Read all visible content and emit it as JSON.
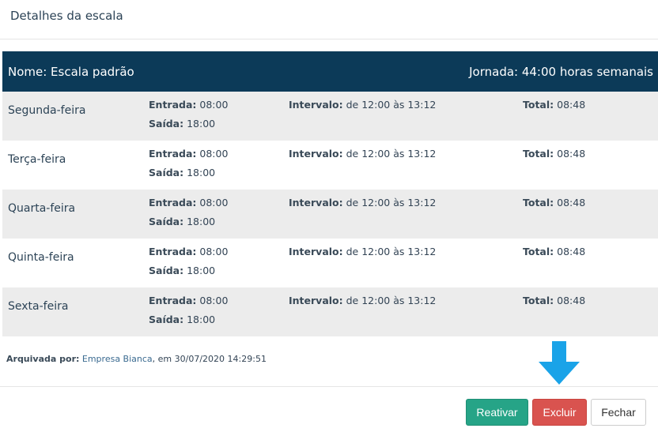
{
  "modal": {
    "title": "Detalhes da escala"
  },
  "schedule": {
    "name_text": "Nome: Escala padrão",
    "jornada_text": "Jornada: 44:00 horas semanais",
    "labels": {
      "entrada": "Entrada:",
      "saida": "Saída:",
      "intervalo": "Intervalo:",
      "total": "Total:"
    },
    "days": [
      {
        "name": "Segunda-feira",
        "entrada": "08:00",
        "saida": "18:00",
        "intervalo": "de 12:00 às 13:12",
        "total": "08:48"
      },
      {
        "name": "Terça-feira",
        "entrada": "08:00",
        "saida": "18:00",
        "intervalo": "de 12:00 às 13:12",
        "total": "08:48"
      },
      {
        "name": "Quarta-feira",
        "entrada": "08:00",
        "saida": "18:00",
        "intervalo": "de 12:00 às 13:12",
        "total": "08:48"
      },
      {
        "name": "Quinta-feira",
        "entrada": "08:00",
        "saida": "18:00",
        "intervalo": "de 12:00 às 13:12",
        "total": "08:48"
      },
      {
        "name": "Sexta-feira",
        "entrada": "08:00",
        "saida": "18:00",
        "intervalo": "de 12:00 às 13:12",
        "total": "08:48"
      }
    ]
  },
  "archived": {
    "label": "Arquivada por:",
    "by": "Empresa Bianca",
    "rest": ", em 30/07/2020 14:29:51"
  },
  "buttons": {
    "reativar": "Reativar",
    "excluir": "Excluir",
    "fechar": "Fechar"
  },
  "colors": {
    "header_bg": "#0c3a58",
    "row_shaded": "#ececec",
    "reativar": "#26a487",
    "excluir": "#d9534f",
    "arrow": "#1aa3e8"
  },
  "icons": {
    "pointer": "arrow-down-icon"
  }
}
